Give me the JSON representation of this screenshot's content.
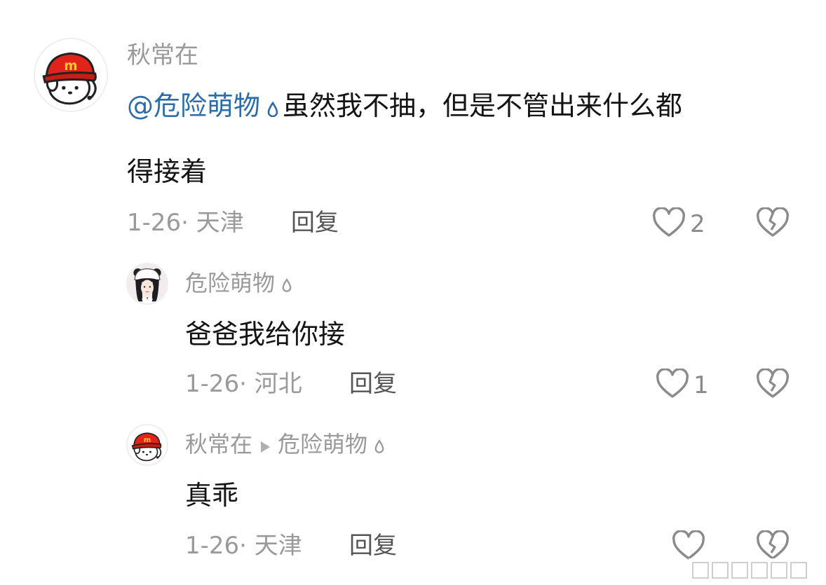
{
  "colors": {
    "username": "#9a9a9a",
    "mention": "#2b6dab",
    "content": "#141414",
    "meta": "#9a9a9a",
    "reply_action": "#555555",
    "icon_stroke": "#8a8a8a"
  },
  "comments": [
    {
      "username": "秋常在",
      "avatar_icon": "mcdonalds-cap-dog-avatar",
      "mention": "@危险萌物",
      "content_line1": "虽然我不抽，但是不管出来什么都",
      "content_line2": "得接着",
      "meta": "1-26· 天津",
      "reply_label": "回复",
      "likes": "2",
      "like_icon": "heart-outline-icon",
      "dislike_icon": "broken-heart-icon"
    },
    {
      "username": "危险萌物",
      "avatar_icon": "anime-girl-panda-hat-avatar",
      "content": "爸爸我给你接",
      "meta": "1-26· 河北",
      "reply_label": "回复",
      "likes": "1",
      "like_icon": "heart-outline-icon",
      "dislike_icon": "broken-heart-icon"
    },
    {
      "username": "秋常在",
      "avatar_icon": "mcdonalds-cap-dog-avatar",
      "reply_to": "危险萌物",
      "content": "真乖",
      "meta": "1-26· 天津",
      "reply_label": "回复",
      "like_icon": "heart-outline-icon",
      "dislike_icon": "broken-heart-icon"
    }
  ]
}
